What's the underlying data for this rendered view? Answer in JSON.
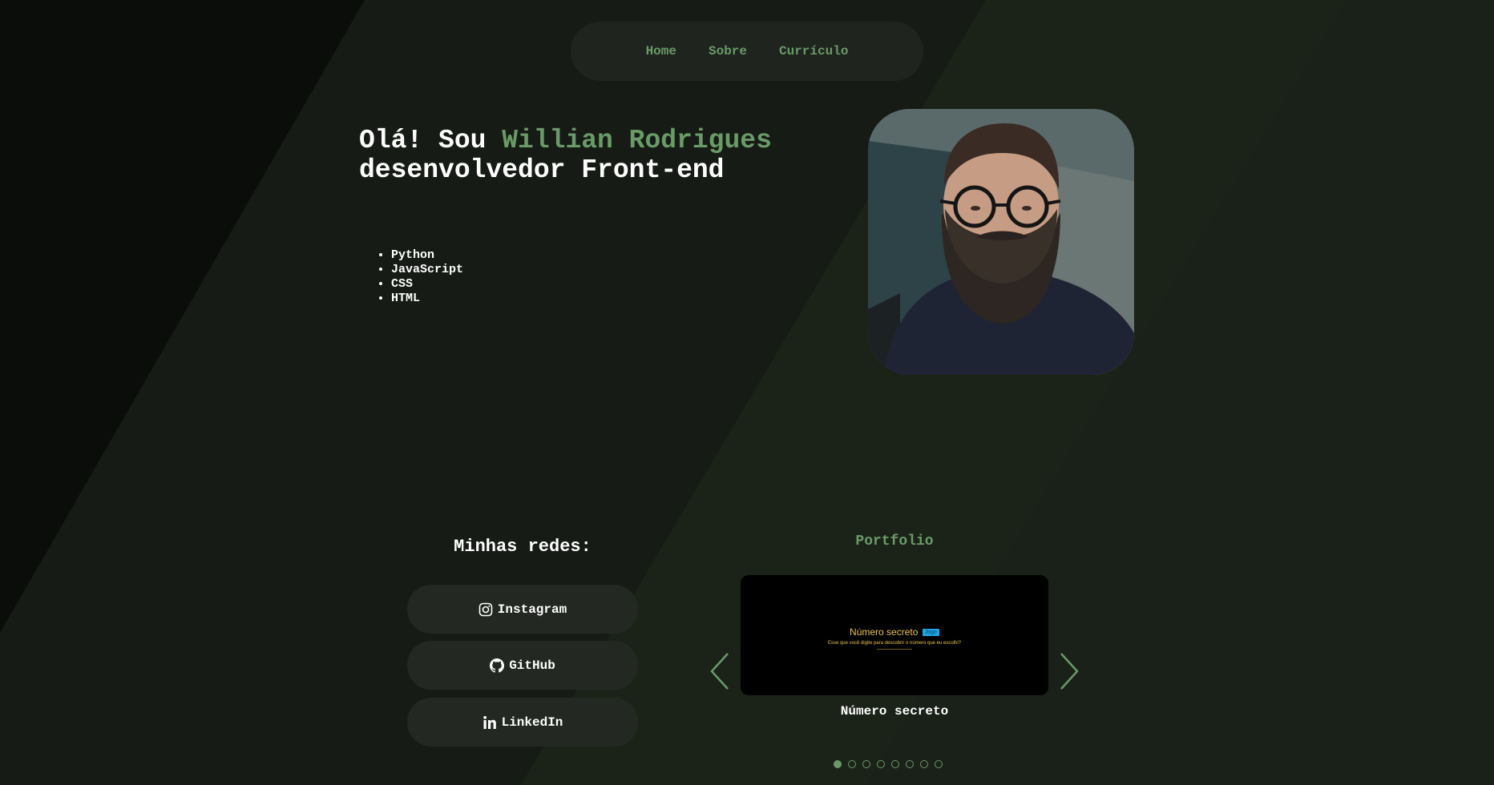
{
  "nav": {
    "items": [
      {
        "label": "Home"
      },
      {
        "label": "Sobre"
      },
      {
        "label": "Currículo"
      }
    ]
  },
  "hero": {
    "greeting": "Olá! Sou ",
    "name": "Willian Rodrigues",
    "role": "desenvolvedor Front-end",
    "skills": [
      "Python",
      "JavaScript",
      "CSS",
      "HTML"
    ]
  },
  "social": {
    "title": "Minhas redes:",
    "links": [
      {
        "label": "Instagram",
        "icon": "instagram-icon"
      },
      {
        "label": "GitHub",
        "icon": "github-icon"
      },
      {
        "label": "LinkedIn",
        "icon": "linkedin-icon"
      }
    ]
  },
  "portfolio": {
    "title": "Portfolio",
    "current_slide": {
      "preview_title": "Número secreto",
      "preview_badge": "Jogo",
      "preview_subtitle": "Esse que você digite para descobrir o número que eu escolhi?",
      "caption": "Número secreto"
    },
    "slide_count": 8,
    "active_index": 0
  },
  "colors": {
    "accent": "#6a9a68",
    "background": "#151a14",
    "nav_bg": "#1f241e",
    "button_bg": "#232822"
  }
}
